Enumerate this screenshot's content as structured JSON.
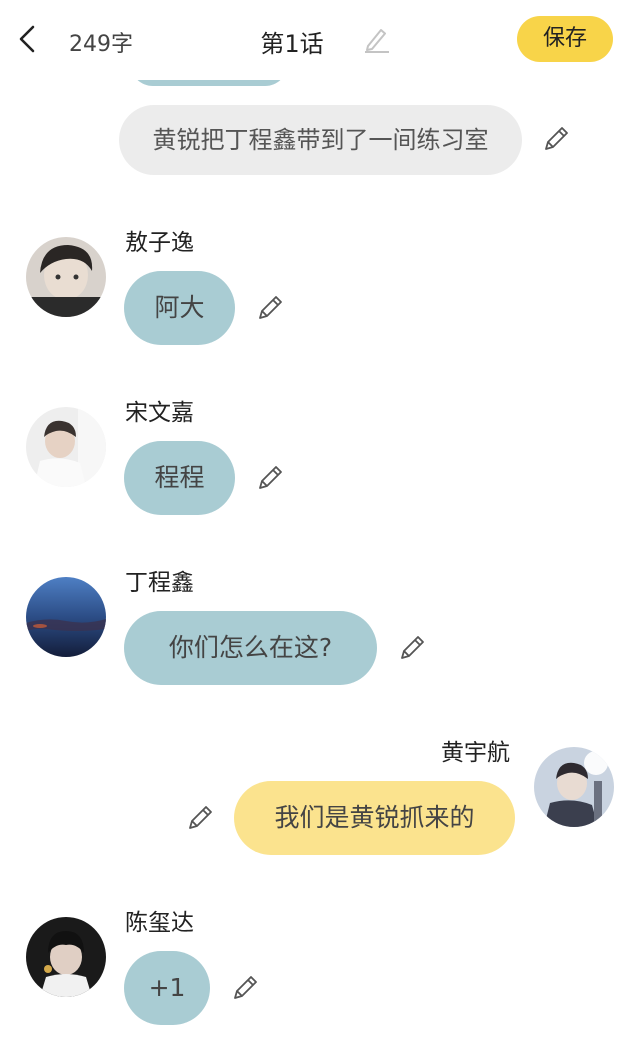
{
  "header": {
    "back_icon": "chevron-left-icon",
    "word_count": "249字",
    "title": "第1话",
    "save_label": "保存"
  },
  "narration": {
    "text": "黄锐把丁程鑫带到了一间练习室"
  },
  "messages": [
    {
      "speaker": "敖子逸",
      "text": "阿大",
      "side": "left"
    },
    {
      "speaker": "宋文嘉",
      "text": "程程",
      "side": "left"
    },
    {
      "speaker": "丁程鑫",
      "text": "你们怎么在这?",
      "side": "left"
    },
    {
      "speaker": "黄宇航",
      "text": "我们是黄锐抓来的",
      "side": "right"
    },
    {
      "speaker": "陈玺达",
      "text": "+1",
      "side": "left"
    }
  ],
  "colors": {
    "accent_yellow": "#f8d449",
    "bubble_left": "#a9ccd3",
    "bubble_right": "#fbe38e",
    "narration_bg": "#ececec"
  }
}
